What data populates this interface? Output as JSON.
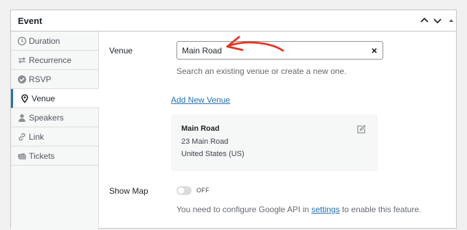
{
  "panel": {
    "title": "Event"
  },
  "tabs": [
    {
      "label": "Duration",
      "icon": "clock-icon",
      "active": false
    },
    {
      "label": "Recurrence",
      "icon": "recurrence-icon",
      "active": false
    },
    {
      "label": "RSVP",
      "icon": "check-circle-icon",
      "active": false
    },
    {
      "label": "Venue",
      "icon": "location-pin-icon",
      "active": true
    },
    {
      "label": "Speakers",
      "icon": "person-icon",
      "active": false
    },
    {
      "label": "Link",
      "icon": "link-icon",
      "active": false
    },
    {
      "label": "Tickets",
      "icon": "ticket-icon",
      "active": false
    }
  ],
  "venue": {
    "label": "Venue",
    "input_value": "Main Road",
    "help": "Search an existing venue or create a new one.",
    "add_link": "Add New Venue",
    "card": {
      "name": "Main Road",
      "address": "23 Main Road",
      "country": "United States (US)"
    }
  },
  "map": {
    "label": "Show Map",
    "toggle_text": "OFF",
    "toggle_on": false,
    "note_before": "You need to configure Google API in ",
    "note_link": "settings",
    "note_after": " to enable this feature."
  },
  "colors": {
    "accent": "#2271b1",
    "annotation_arrow": "#e8321f"
  }
}
